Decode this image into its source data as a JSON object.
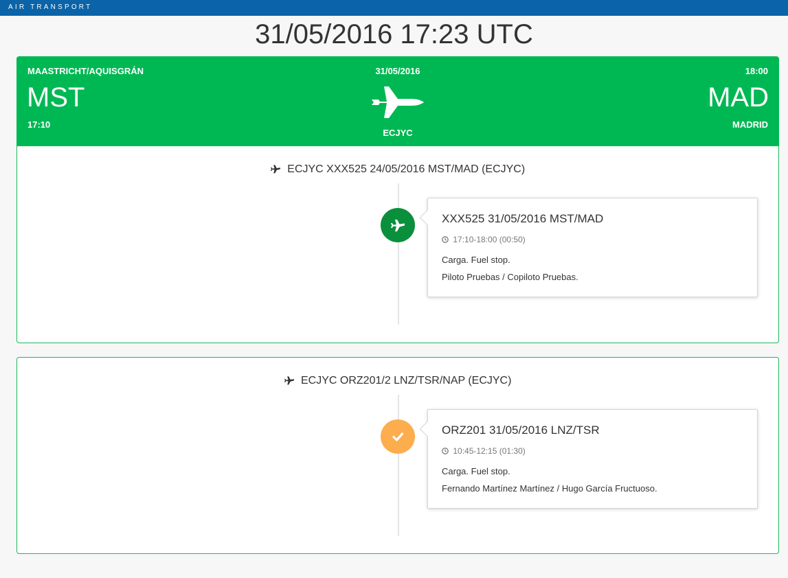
{
  "app": {
    "brand": "AIR TRANSPORT"
  },
  "clock": "31/05/2016 17:23 UTC",
  "summary": {
    "origin_name": "MAASTRICHT/AQUISGRÁN",
    "origin_code": "MST",
    "origin_time": "17:10",
    "date": "31/05/2016",
    "registration": "ECJYC",
    "dest_time": "18:00",
    "dest_code": "MAD",
    "dest_name": "MADRID",
    "icon": "fighter-jet-icon",
    "color": "#00b853"
  },
  "panels": [
    {
      "title": "ECJYC XXX525 24/05/2016 MST/MAD  (ECJYC)",
      "title_icon": "plane-icon",
      "badge_icon": "plane-icon",
      "badge_color": "#0a8f3c",
      "card": {
        "title": "XXX525 31/05/2016 MST/MAD",
        "time": "17:10-18:00 (00:50)",
        "line1": "Carga. Fuel stop.",
        "line2": "Piloto Pruebas / Copiloto Pruebas."
      }
    },
    {
      "title": "ECJYC ORZ201/2 LNZ/TSR/NAP  (ECJYC)",
      "title_icon": "plane-icon",
      "badge_icon": "check-icon",
      "badge_color": "#fcad4e",
      "card": {
        "title": "ORZ201 31/05/2016 LNZ/TSR",
        "time": "10:45-12:15 (01:30)",
        "line1": "Carga. Fuel stop.",
        "line2": "Fernando Martínez Martínez / Hugo García Fructuoso."
      }
    }
  ]
}
